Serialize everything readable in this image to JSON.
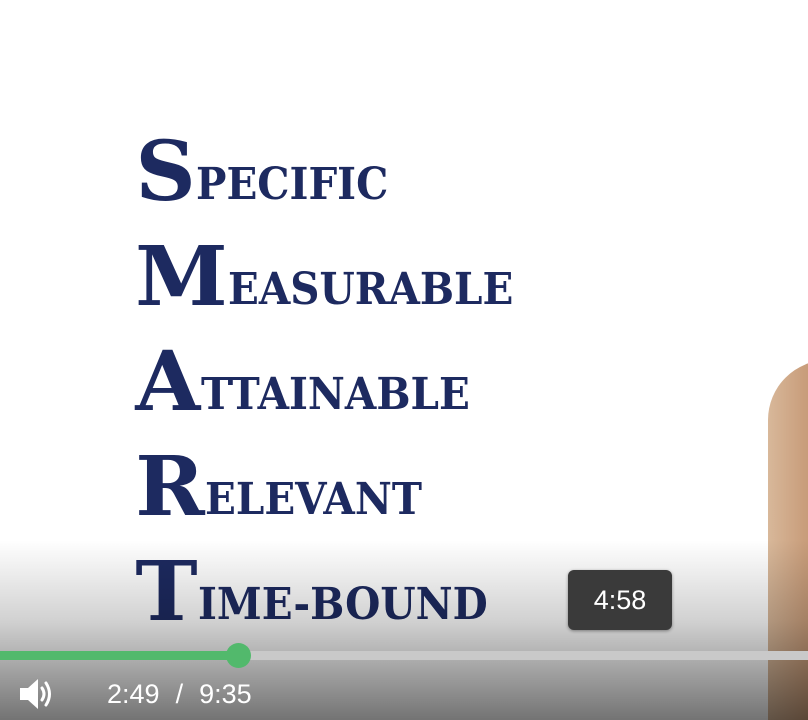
{
  "video": {
    "slide": {
      "words": [
        {
          "initial": "S",
          "rest": "pecific"
        },
        {
          "initial": "M",
          "rest": "easurable"
        },
        {
          "initial": "A",
          "rest": "ttainable"
        },
        {
          "initial": "R",
          "rest": "elevant"
        },
        {
          "initial": "T",
          "rest": "ime-bound"
        }
      ],
      "text_color": "#1d2a60"
    }
  },
  "player": {
    "hover_tooltip": "4:58",
    "current_time": "2:49",
    "separator": "/",
    "duration": "9:35",
    "progress_fraction": 0.295,
    "colors": {
      "played": "#52b96c",
      "track": "#c9c9c9",
      "tooltip_bg": "#3a3a3a"
    },
    "icons": {
      "volume": "volume-icon"
    }
  }
}
